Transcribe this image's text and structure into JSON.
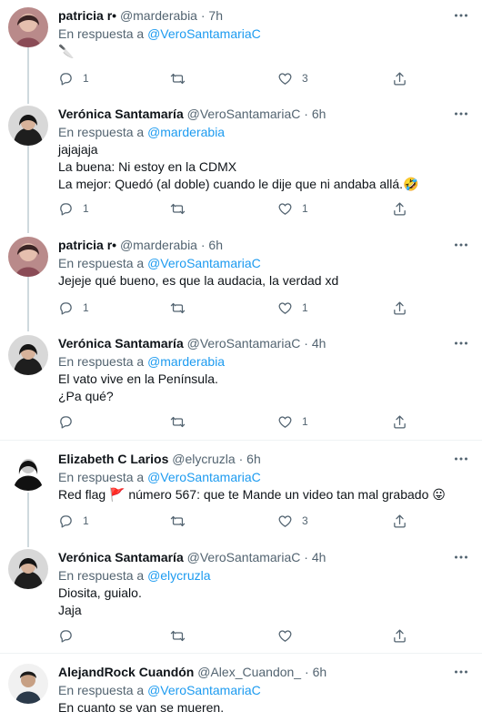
{
  "reply_prefix": "En respuesta a",
  "tweets": [
    {
      "name": "patricia r•",
      "handle": "@marderabia",
      "time": "7h",
      "reply_to": "@VeroSantamariaC",
      "lines": [
        "🔪"
      ],
      "replies": "1",
      "retweets": "",
      "likes": "3"
    },
    {
      "name": "Verónica Santamaría",
      "handle": "@VeroSantamariaC",
      "time": "6h",
      "reply_to": "@marderabia",
      "lines": [
        "jajajaja",
        "La buena: Ni estoy en la CDMX",
        "La mejor: Quedó (al doble) cuando le dije que ni andaba allá.🤣"
      ],
      "replies": "1",
      "retweets": "",
      "likes": "1"
    },
    {
      "name": "patricia r•",
      "handle": "@marderabia",
      "time": "6h",
      "reply_to": "@VeroSantamariaC",
      "lines": [
        "Jejeje qué bueno, es que la audacia, la verdad xd"
      ],
      "replies": "1",
      "retweets": "",
      "likes": "1"
    },
    {
      "name": "Verónica Santamaría",
      "handle": "@VeroSantamariaC",
      "time": "4h",
      "reply_to": "@marderabia",
      "lines": [
        "El vato vive en la Península.",
        "¿Pa qué?"
      ],
      "replies": "",
      "retweets": "",
      "likes": "1"
    },
    {
      "name": "Elizabeth C Larios",
      "handle": "@elycruzla",
      "time": "6h",
      "reply_to": "@VeroSantamariaC",
      "lines": [
        "Red flag 🚩 número 567: que te Mande un video tan mal grabado 😛"
      ],
      "replies": "1",
      "retweets": "",
      "likes": "3"
    },
    {
      "name": "Verónica Santamaría",
      "handle": "@VeroSantamariaC",
      "time": "4h",
      "reply_to": "@elycruzla",
      "lines": [
        "Diosita, guialo.",
        "Jaja"
      ],
      "replies": "",
      "retweets": "",
      "likes": ""
    },
    {
      "name": "AlejandRock Cuandón",
      "handle": "@Alex_Cuandon_",
      "time": "6h",
      "reply_to": "@VeroSantamariaC",
      "lines": [
        "En cuanto se van se mueren."
      ],
      "replies": "",
      "retweets": "",
      "likes": ""
    }
  ],
  "icons": {
    "reply": "reply-icon",
    "retweet": "retweet-icon",
    "like": "heart-icon",
    "share": "share-icon",
    "more": "more-icon"
  },
  "colors": {
    "link": "#1d9bf0",
    "secondary": "#536471",
    "thread_line": "#cfd9de",
    "separator": "#eff3f4"
  }
}
